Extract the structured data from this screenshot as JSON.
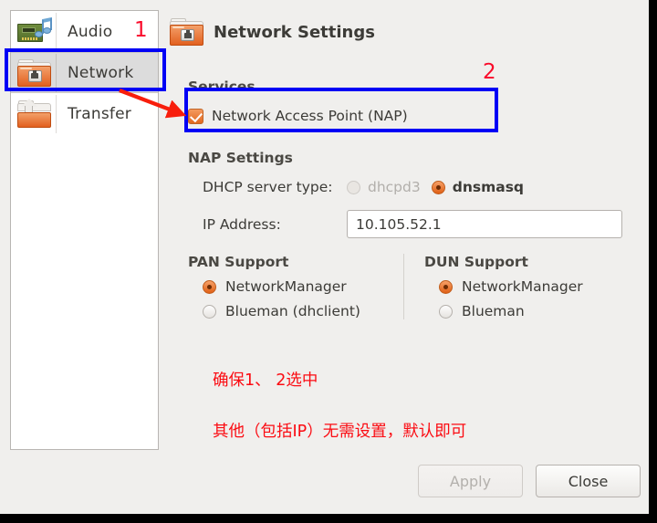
{
  "window": {
    "title": "Network Settings"
  },
  "sidebar": {
    "items": [
      {
        "label": "Audio",
        "icon": "audio-card-icon",
        "selected": false
      },
      {
        "label": "Network",
        "icon": "network-folder-icon",
        "selected": true
      },
      {
        "label": "Transfer",
        "icon": "transfer-folder-icon",
        "selected": false
      }
    ]
  },
  "main": {
    "header": {
      "icon": "network-folder-icon",
      "title": "Network Settings"
    },
    "services": {
      "group_title": "Services",
      "nap_checkbox": {
        "label": "Network Access Point (NAP)",
        "checked": true
      }
    },
    "nap_settings": {
      "group_title": "NAP Settings",
      "dhcp": {
        "label": "DHCP server type:",
        "options": [
          {
            "label": "dhcpd3",
            "selected": false,
            "disabled": true
          },
          {
            "label": "dnsmasq",
            "selected": true,
            "disabled": false
          }
        ]
      },
      "ip_address": {
        "label": "IP Address:",
        "value": "10.105.52.1",
        "placeholder": ""
      }
    },
    "pan_support": {
      "group_title": "PAN Support",
      "options": [
        {
          "label": "NetworkManager",
          "selected": true
        },
        {
          "label": "Blueman (dhclient)",
          "selected": false
        }
      ]
    },
    "dun_support": {
      "group_title": "DUN Support",
      "options": [
        {
          "label": "NetworkManager",
          "selected": true
        },
        {
          "label": "Blueman",
          "selected": false
        }
      ]
    }
  },
  "annotations": {
    "marker_1": "1",
    "marker_2": "2",
    "note_1": "确保1、 2选中",
    "note_2": "其他（包括IP）无需设置，默认即可",
    "box_color": "#0000f5",
    "marker_color": "#fa0a2a",
    "note_color": "#fb0b12",
    "arrow_color": "#f81e0c"
  },
  "footer": {
    "apply_label": "Apply",
    "apply_disabled": true,
    "close_label": "Close",
    "close_disabled": false
  }
}
